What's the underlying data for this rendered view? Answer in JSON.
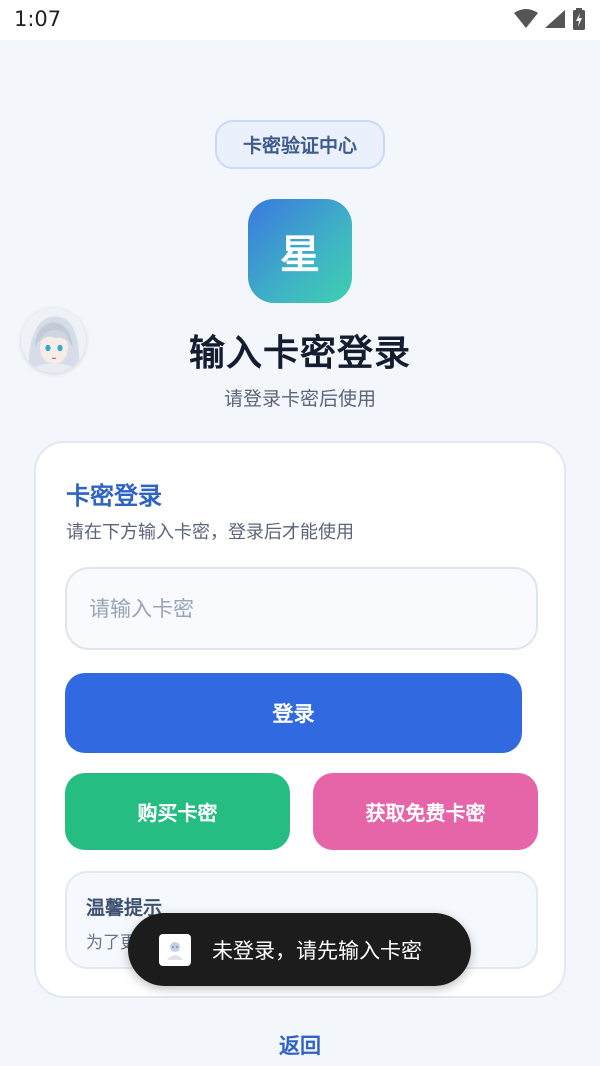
{
  "status_bar": {
    "time": "1:07"
  },
  "header": {
    "badge": "卡密验证中心",
    "logo_char": "星",
    "title": "输入卡密登录",
    "subtitle": "请登录卡密后使用"
  },
  "card": {
    "title": "卡密登录",
    "description": "请在下方输入卡密，登录后才能使用",
    "input": {
      "placeholder": "请输入卡密",
      "value": ""
    },
    "login_button": "登录",
    "buy_button": "购买卡密",
    "free_button": "获取免费卡密",
    "tip": {
      "title": "温馨提示",
      "text": "为了更"
    }
  },
  "toast": {
    "text": "未登录，请先输入卡密"
  },
  "footer": {
    "back_link": "返回"
  },
  "colors": {
    "accent_blue": "#3069e0",
    "buy_green": "#25bd82",
    "free_pink": "#e664a8",
    "title_blue": "#2f63c4",
    "page_bg": "#f3f6fb"
  }
}
